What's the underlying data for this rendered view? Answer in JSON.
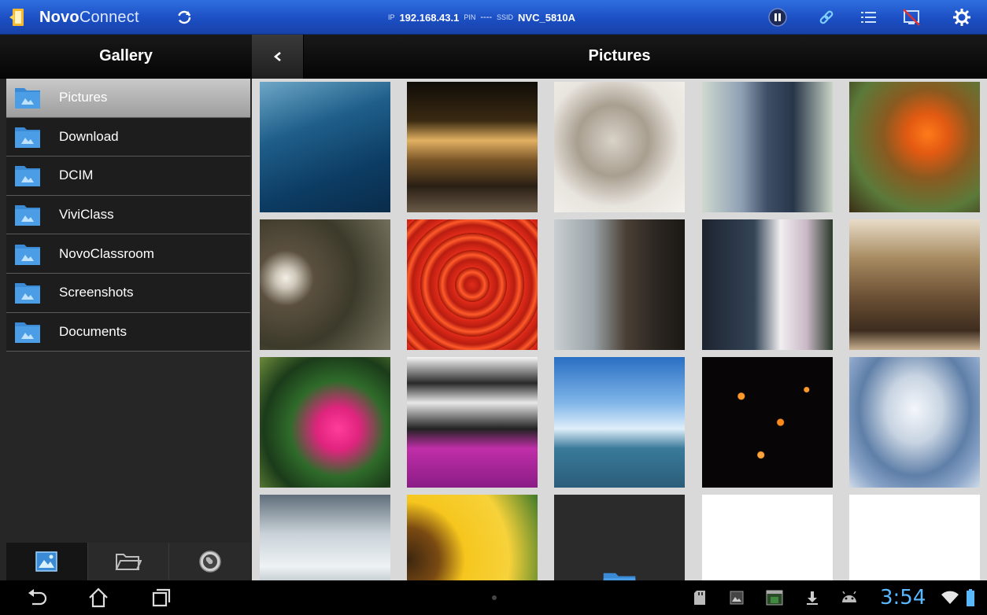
{
  "app": {
    "name_bold": "Novo",
    "name_rest": "Connect"
  },
  "connection": {
    "ip_label": "IP",
    "ip_value": "192.168.43.1",
    "pin_label": "PIN",
    "pin_value": "----",
    "ssid_label": "SSID",
    "ssid_value": "NVC_5810A"
  },
  "topbar_icons": [
    "refresh-icon",
    "pause-icon",
    "link-icon",
    "list-icon",
    "no-screen-icon",
    "settings-icon"
  ],
  "sidebar": {
    "title": "Gallery",
    "folders": [
      {
        "label": "Pictures",
        "active": true
      },
      {
        "label": "Download"
      },
      {
        "label": "DCIM"
      },
      {
        "label": "ViviClass"
      },
      {
        "label": "NovoClassroom"
      },
      {
        "label": "Screenshots"
      },
      {
        "label": "Documents"
      }
    ],
    "tabs": [
      "gallery-icon",
      "folder-icon",
      "globe-icon"
    ]
  },
  "main": {
    "title": "Pictures",
    "photos": [
      {
        "subject": "lake-from-above"
      },
      {
        "subject": "night-building"
      },
      {
        "subject": "sleeping-kitten"
      },
      {
        "subject": "couple-walking"
      },
      {
        "subject": "clownfish"
      },
      {
        "subject": "white-flower"
      },
      {
        "subject": "red-lanterns"
      },
      {
        "subject": "cat-at-window"
      },
      {
        "subject": "orchids-by-shelves"
      },
      {
        "subject": "ornate-building"
      },
      {
        "subject": "pink-lily"
      },
      {
        "subject": "purple-orchids"
      },
      {
        "subject": "harbor-boats"
      },
      {
        "subject": "sky-lanterns"
      },
      {
        "subject": "cloudy-sky"
      },
      {
        "subject": "misty-rocks"
      },
      {
        "subject": "sunflower"
      },
      {
        "subject": "subfolder"
      },
      {
        "subject": "blank"
      },
      {
        "subject": "blank"
      }
    ]
  },
  "status": {
    "time": "3:54"
  },
  "colors": {
    "topbar": "#1c4fc4",
    "accent_blue": "#5ab8ff",
    "folder_blue": "#3a8ad6"
  }
}
